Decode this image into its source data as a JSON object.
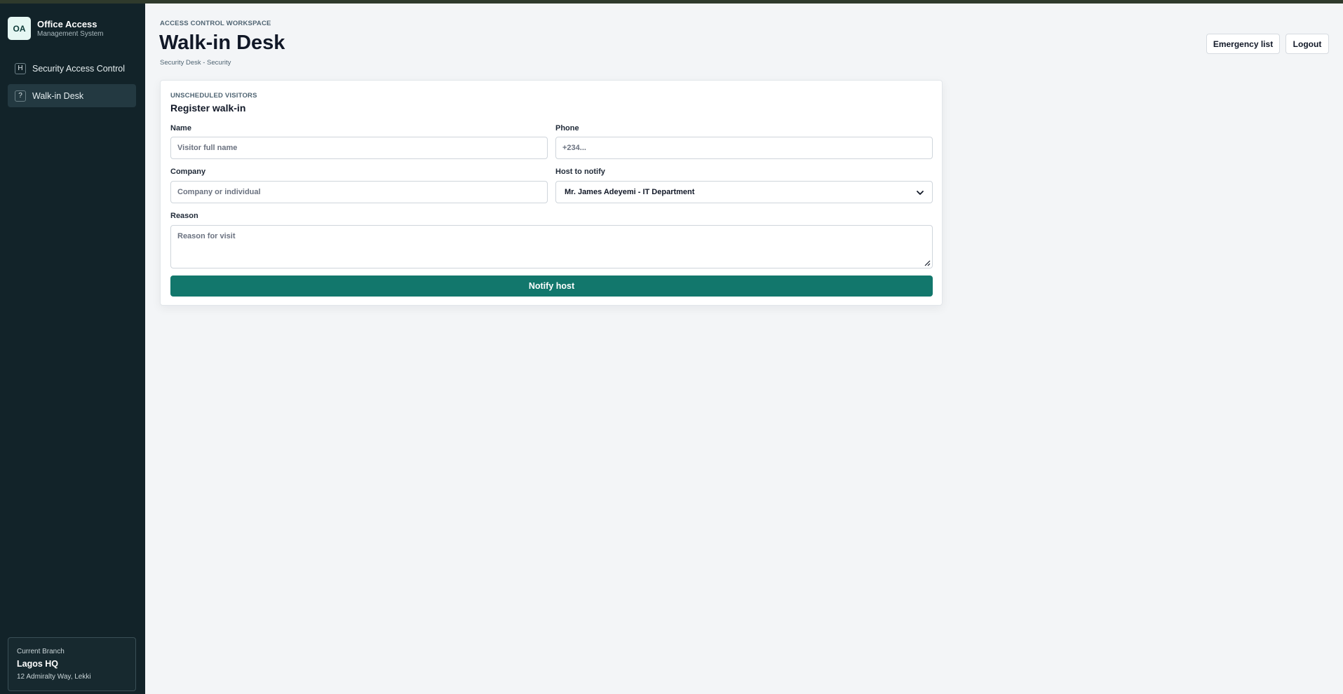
{
  "brand": {
    "logo": "OA",
    "title": "Office Access",
    "subtitle": "Management System"
  },
  "sidebar": {
    "items": [
      {
        "icon": "H",
        "label": "Security Access Control",
        "active": false
      },
      {
        "icon": "?",
        "label": "Walk-in Desk",
        "active": true
      }
    ],
    "branch": {
      "label": "Current Branch",
      "name": "Lagos HQ",
      "address": "12 Admiralty Way, Lekki"
    }
  },
  "header": {
    "eyebrow": "ACCESS CONTROL WORKSPACE",
    "title": "Walk-in Desk",
    "subtitle": "Security Desk - Security",
    "emergency_label": "Emergency list",
    "logout_label": "Logout"
  },
  "form": {
    "eyebrow": "UNSCHEDULED VISITORS",
    "title": "Register walk-in",
    "name_label": "Name",
    "name_placeholder": "Visitor full name",
    "phone_label": "Phone",
    "phone_placeholder": "+234...",
    "company_label": "Company",
    "company_placeholder": "Company or individual",
    "host_label": "Host to notify",
    "host_selected": "Mr. James Adeyemi - IT Department",
    "reason_label": "Reason",
    "reason_placeholder": "Reason for visit",
    "submit_label": "Notify host"
  },
  "colors": {
    "sidebar_bg": "#122329",
    "accent": "#12776c",
    "page_bg": "#f3f5f7"
  }
}
